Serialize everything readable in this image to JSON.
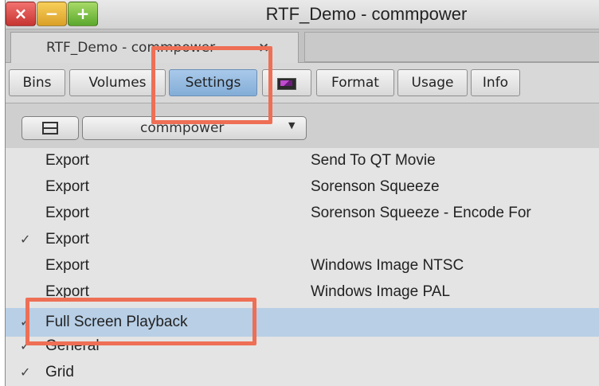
{
  "window": {
    "title": "RTF_Demo - commpower",
    "controls": {
      "close": "×",
      "minimize": "−",
      "zoom": "+"
    }
  },
  "document_tab": {
    "label": "RTF_Demo - commpower",
    "close": "×"
  },
  "tabs": [
    {
      "label": "Bins"
    },
    {
      "label": "Volumes"
    },
    {
      "label": "Settings",
      "active": true
    },
    {
      "label": "",
      "icon": "monitor-color-icon"
    },
    {
      "label": "Format"
    },
    {
      "label": "Usage"
    },
    {
      "label": "Info"
    }
  ],
  "toolbar": {
    "view_icon": "split-view-icon",
    "dropdown_value": "commpower",
    "dropdown_arrow": "▼"
  },
  "rows": [
    {
      "check": "",
      "name": "Export",
      "value": "Send To QT Movie"
    },
    {
      "check": "",
      "name": "Export",
      "value": "Sorenson Squeeze"
    },
    {
      "check": "",
      "name": "Export",
      "value": "Sorenson Squeeze - Encode For"
    },
    {
      "check": "✓",
      "name": "Export",
      "value": ""
    },
    {
      "check": "",
      "name": "Export",
      "value": "Windows Image NTSC"
    },
    {
      "check": "",
      "name": "Export",
      "value": "Windows Image PAL"
    },
    {
      "check": "✓",
      "name": "Full Screen Playback",
      "value": "",
      "selected": true
    },
    {
      "check": "✓",
      "name": "General",
      "value": ""
    },
    {
      "check": "✓",
      "name": "Grid",
      "value": ""
    }
  ],
  "colors": {
    "highlight": "#ee6f55",
    "selected_row": "#b8cfe6",
    "active_tab": "#83add7"
  }
}
